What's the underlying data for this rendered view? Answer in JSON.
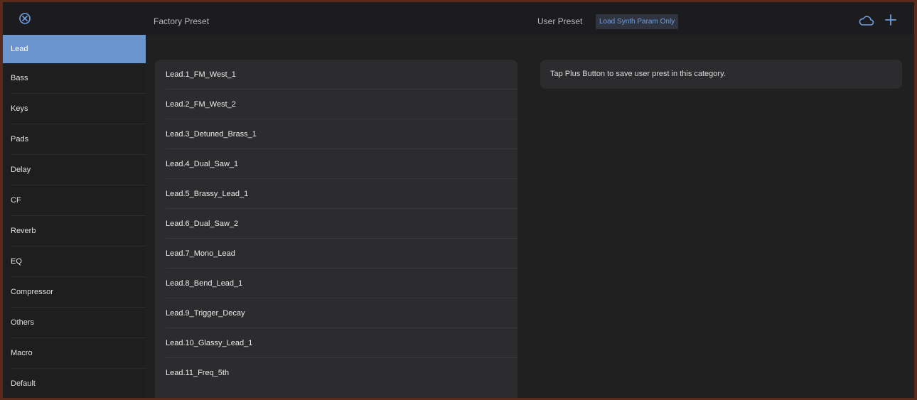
{
  "header": {
    "factory_title": "Factory Preset",
    "user_title": "User Preset",
    "load_button": "Load Synth Param Only",
    "icons": {
      "close": "circled-x-icon",
      "cloud": "cloud-icon",
      "plus": "plus-icon"
    }
  },
  "colors": {
    "accent": "#6b95cf",
    "load_text": "#6e9fe0"
  },
  "sidebar": {
    "selected": "Lead",
    "items": [
      {
        "label": "Lead"
      },
      {
        "label": "Bass"
      },
      {
        "label": "Keys"
      },
      {
        "label": "Pads"
      },
      {
        "label": "Delay"
      },
      {
        "label": "CF"
      },
      {
        "label": "Reverb"
      },
      {
        "label": "EQ"
      },
      {
        "label": "Compressor"
      },
      {
        "label": "Others"
      },
      {
        "label": "Macro"
      },
      {
        "label": "Default"
      }
    ]
  },
  "factory_presets": [
    {
      "label": "Lead.1_FM_West_1"
    },
    {
      "label": "Lead.2_FM_West_2"
    },
    {
      "label": "Lead.3_Detuned_Brass_1"
    },
    {
      "label": "Lead.4_Dual_Saw_1"
    },
    {
      "label": "Lead.5_Brassy_Lead_1"
    },
    {
      "label": "Lead.6_Dual_Saw_2"
    },
    {
      "label": "Lead.7_Mono_Lead"
    },
    {
      "label": "Lead.8_Bend_Lead_1"
    },
    {
      "label": "Lead.9_Trigger_Decay"
    },
    {
      "label": "Lead.10_Glassy_Lead_1"
    },
    {
      "label": "Lead.11_Freq_5th"
    }
  ],
  "user_presets": {
    "empty_message": "Tap Plus Button to save user prest in this category."
  }
}
